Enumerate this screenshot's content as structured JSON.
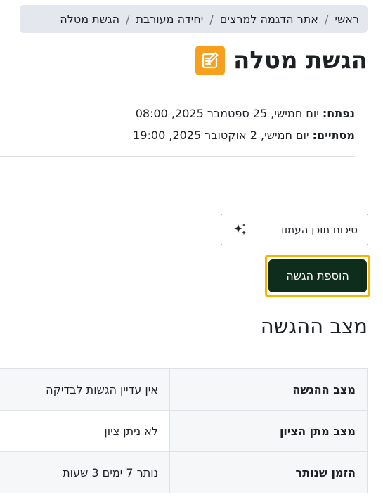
{
  "breadcrumb": {
    "items": [
      "ראשי",
      "אתר הדגמה למרצים",
      "יחידה מעורבת",
      "הגשת מטלה"
    ],
    "separator": "/"
  },
  "page": {
    "icon": "assignment-icon",
    "title": "הגשת מטלה"
  },
  "dates": {
    "opened_label": "נפתח:",
    "opened_value": "יום חמישי, 25 ספטמבר 2025, 08:00",
    "due_label": "מסתיים:",
    "due_value": "יום חמישי, 2 אוקטובר 2025, 19:00"
  },
  "actions": {
    "summary_label": "סיכום תוכן העמוד",
    "summary_icon": "sparkles-icon",
    "add_submission_label": "הוספת הגשה"
  },
  "status": {
    "heading": "מצב ההגשה",
    "rows": [
      {
        "label": "מצב ההגשה",
        "value": "אין עדיין הגשות לבדיקה"
      },
      {
        "label": "מצב מתן הציון",
        "value": "לא ניתן ציון"
      },
      {
        "label": "הזמן שנותר",
        "value": "נותר 7 ימים 3 שעות"
      }
    ]
  },
  "colors": {
    "accent": "#f7a01d",
    "primary_button": "#0f2d1c",
    "focus_ring": "#f5b400",
    "breadcrumb_bg": "#e4e8ee"
  }
}
